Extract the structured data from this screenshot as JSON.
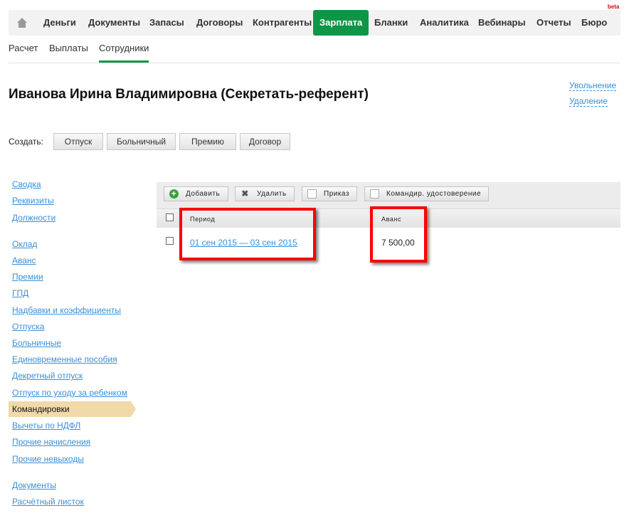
{
  "topnav": {
    "items": [
      "Деньги",
      "Документы",
      "Запасы",
      "Договоры",
      "Контрагенты",
      "Зарплата",
      "Бланки",
      "Аналитика",
      "Вебинары",
      "Отчеты",
      "Бюро"
    ],
    "active": "Зарплата",
    "beta": "beta"
  },
  "subnav": {
    "items": [
      "Расчет",
      "Выплаты",
      "Сотрудники"
    ],
    "active": "Сотрудники"
  },
  "title": "Иванова Ирина Владимировна (Секретать-референт)",
  "actions": {
    "dismiss": "Увольнение",
    "delete": "Удаление"
  },
  "create": {
    "label": "Создать:",
    "buttons": [
      "Отпуск",
      "Больничный",
      "Премию",
      "Договор"
    ]
  },
  "sidebar": {
    "group1": [
      "Сводка",
      "Реквизиты",
      "Должности"
    ],
    "group2": [
      "Оклад",
      "Аванс",
      "Премии",
      "ГПД",
      "Надбавки и коэффициенты",
      "Отпуска",
      "Больничные",
      "Единовременные пособия",
      "Декретный отпуск",
      "Отпуск по уходу за ребенком",
      "Командировки",
      "Вычеты по НДФЛ",
      "Прочие начисления",
      "Прочие невыходы"
    ],
    "group3": [
      "Документы",
      "Расчётный листок"
    ],
    "selected": "Командировки"
  },
  "toolbar": {
    "add": "Добавить",
    "remove": "Удалить",
    "order": "Приказ",
    "certificate": "Командир. удостоверение"
  },
  "table": {
    "columns": [
      "Период",
      "Аванс"
    ],
    "rows": [
      {
        "period": "01 сен 2015 — 03 сен 2015",
        "advance": "7 500,00"
      }
    ]
  },
  "colors": {
    "accent": "#0e9647",
    "link": "#3a8fd8",
    "highlight": "#f2d9aa"
  }
}
